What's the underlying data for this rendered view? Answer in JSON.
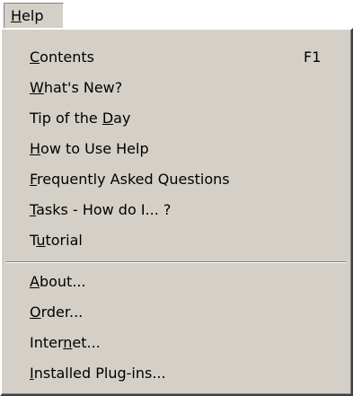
{
  "menubar": {
    "help_label": "Help",
    "help_mnemonic": "H"
  },
  "menu": {
    "group1": [
      {
        "id": "contents",
        "pre": "",
        "mnemonic": "C",
        "post": "ontents",
        "shortcut": "F1"
      },
      {
        "id": "whats-new",
        "pre": "",
        "mnemonic": "W",
        "post": "hat's New?",
        "shortcut": ""
      },
      {
        "id": "tip-of-the-day",
        "pre": "Tip of the ",
        "mnemonic": "D",
        "post": "ay",
        "shortcut": ""
      },
      {
        "id": "how-to-use-help",
        "pre": "",
        "mnemonic": "H",
        "post": "ow to Use Help",
        "shortcut": ""
      },
      {
        "id": "faq",
        "pre": "",
        "mnemonic": "F",
        "post": "requently Asked Questions",
        "shortcut": ""
      },
      {
        "id": "tasks",
        "pre": "",
        "mnemonic": "T",
        "post": "asks - How do I... ?",
        "shortcut": ""
      },
      {
        "id": "tutorial",
        "pre": "T",
        "mnemonic": "u",
        "post": "torial",
        "shortcut": ""
      }
    ],
    "group2": [
      {
        "id": "about",
        "pre": "",
        "mnemonic": "A",
        "post": "bout...",
        "shortcut": ""
      },
      {
        "id": "order",
        "pre": "",
        "mnemonic": "O",
        "post": "rder...",
        "shortcut": ""
      },
      {
        "id": "internet",
        "pre": "Inter",
        "mnemonic": "n",
        "post": "et...",
        "shortcut": ""
      },
      {
        "id": "installed-plugins",
        "pre": "",
        "mnemonic": "I",
        "post": "nstalled Plug-ins...",
        "shortcut": ""
      }
    ]
  }
}
